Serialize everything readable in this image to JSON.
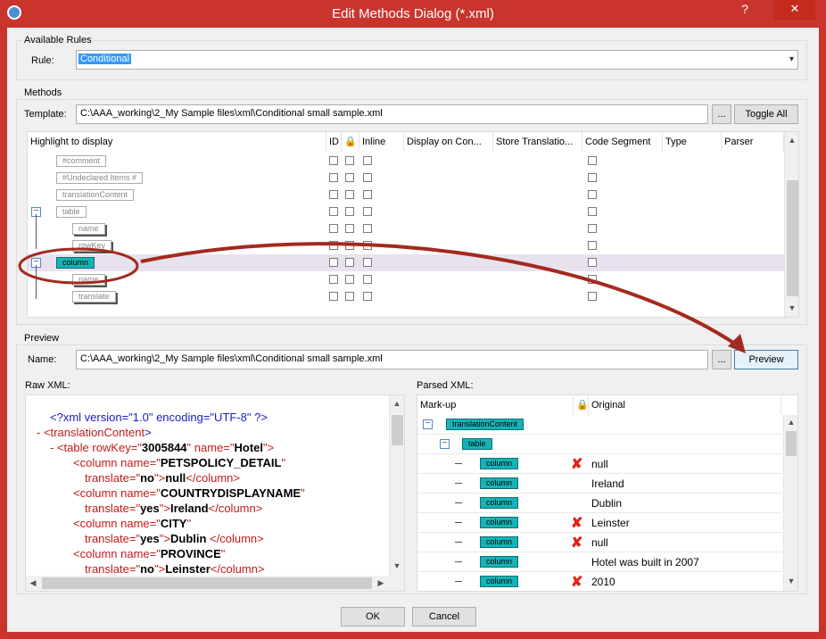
{
  "window": {
    "title": "Edit Methods Dialog (*.xml)",
    "help": "?",
    "close": "✕"
  },
  "available_rules": {
    "group_label": "Available Rules",
    "rule_label": "Rule:",
    "rule_value": "Conditional"
  },
  "methods": {
    "group_label": "Methods",
    "template_label": "Template:",
    "template_path": "C:\\AAA_working\\2_My Sample files\\xml\\Conditional small sample.xml",
    "browse_label": "...",
    "toggle_all_label": "Toggle All",
    "columns": [
      "Highlight to display",
      "ID",
      "Inline",
      "Display on Con...",
      "Store Translatio...",
      "Code Segment",
      "Type",
      "Parser"
    ],
    "rows": [
      {
        "tag": "#comment"
      },
      {
        "tag": "#Undeclared Items #"
      },
      {
        "tag": "translationContent"
      },
      {
        "tag": "table"
      },
      {
        "tag": "name"
      },
      {
        "tag": "rowKey"
      },
      {
        "tag": "column"
      },
      {
        "tag": "name"
      },
      {
        "tag": "translate"
      }
    ]
  },
  "preview": {
    "group_label": "Preview",
    "name_label": "Name:",
    "name_path": "C:\\AAA_working\\2_My Sample files\\xml\\Conditional small sample.xml",
    "browse_label": "...",
    "preview_button": "Preview",
    "raw_xml_label": "Raw XML:",
    "parsed_xml_label": "Parsed XML:",
    "raw_xml": {
      "l1": "<?xml version=\"1.0\" encoding=\"UTF-8\" ?>",
      "l2_open": "- <",
      "l2_tag": "translationContent",
      "l2_close": ">",
      "l3_open": "- <",
      "l3_tag": "table",
      "l3_a1": " rowKey=\"",
      "l3_v1": "3005844",
      "l3_a2": "\" name=\"",
      "l3_v2": "Hotel",
      "l3_end": "\">",
      "c1_a": "<column name=\"",
      "c1_v": "PETSPOLICY_DETAIL",
      "c1_q": "\"",
      "c1_t": "translate=\"",
      "c1_tv": "no",
      "c1_m": "\">",
      "c1_text": "null",
      "c1_close": "</column>",
      "c2_a": "<column name=\"",
      "c2_v": "COUNTRYDISPLAYNAME",
      "c2_q": "\"",
      "c2_t": "translate=\"",
      "c2_tv": "yes",
      "c2_m": "\">",
      "c2_text": "Ireland",
      "c2_close": "</column>",
      "c3_a": "<column name=\"",
      "c3_v": "CITY",
      "c3_q": "\"",
      "c3_t": "translate=\"",
      "c3_tv": "yes",
      "c3_m": "\">",
      "c3_text": "Dublin",
      "c3_close": " </column>",
      "c4_a": "<column name=\"",
      "c4_v": "PROVINCE",
      "c4_q": "\"",
      "c4_t": "translate=\"",
      "c4_tv": "no",
      "c4_m": "\">",
      "c4_text": "Leinster",
      "c4_close": "</column>"
    },
    "parsed": {
      "col_markup": "Mark-up",
      "col_original": "Original",
      "root_tag": "translationContent",
      "table_tag": "table",
      "rows": [
        {
          "tag": "column",
          "x": true,
          "text": "null"
        },
        {
          "tag": "column",
          "x": false,
          "text": "Ireland"
        },
        {
          "tag": "column",
          "x": false,
          "text": "Dublin"
        },
        {
          "tag": "column",
          "x": true,
          "text": "Leinster"
        },
        {
          "tag": "column",
          "x": true,
          "text": "null"
        },
        {
          "tag": "column",
          "x": false,
          "text": "Hotel was built in 2007"
        },
        {
          "tag": "column",
          "x": true,
          "text": "2010"
        }
      ],
      "x_mark": "✘"
    }
  },
  "footer": {
    "ok": "OK",
    "cancel": "Cancel"
  },
  "colors": {
    "titlebar": "#c9342d",
    "tag_teal": "#16b3b6",
    "annotation": "#a32a1f"
  }
}
